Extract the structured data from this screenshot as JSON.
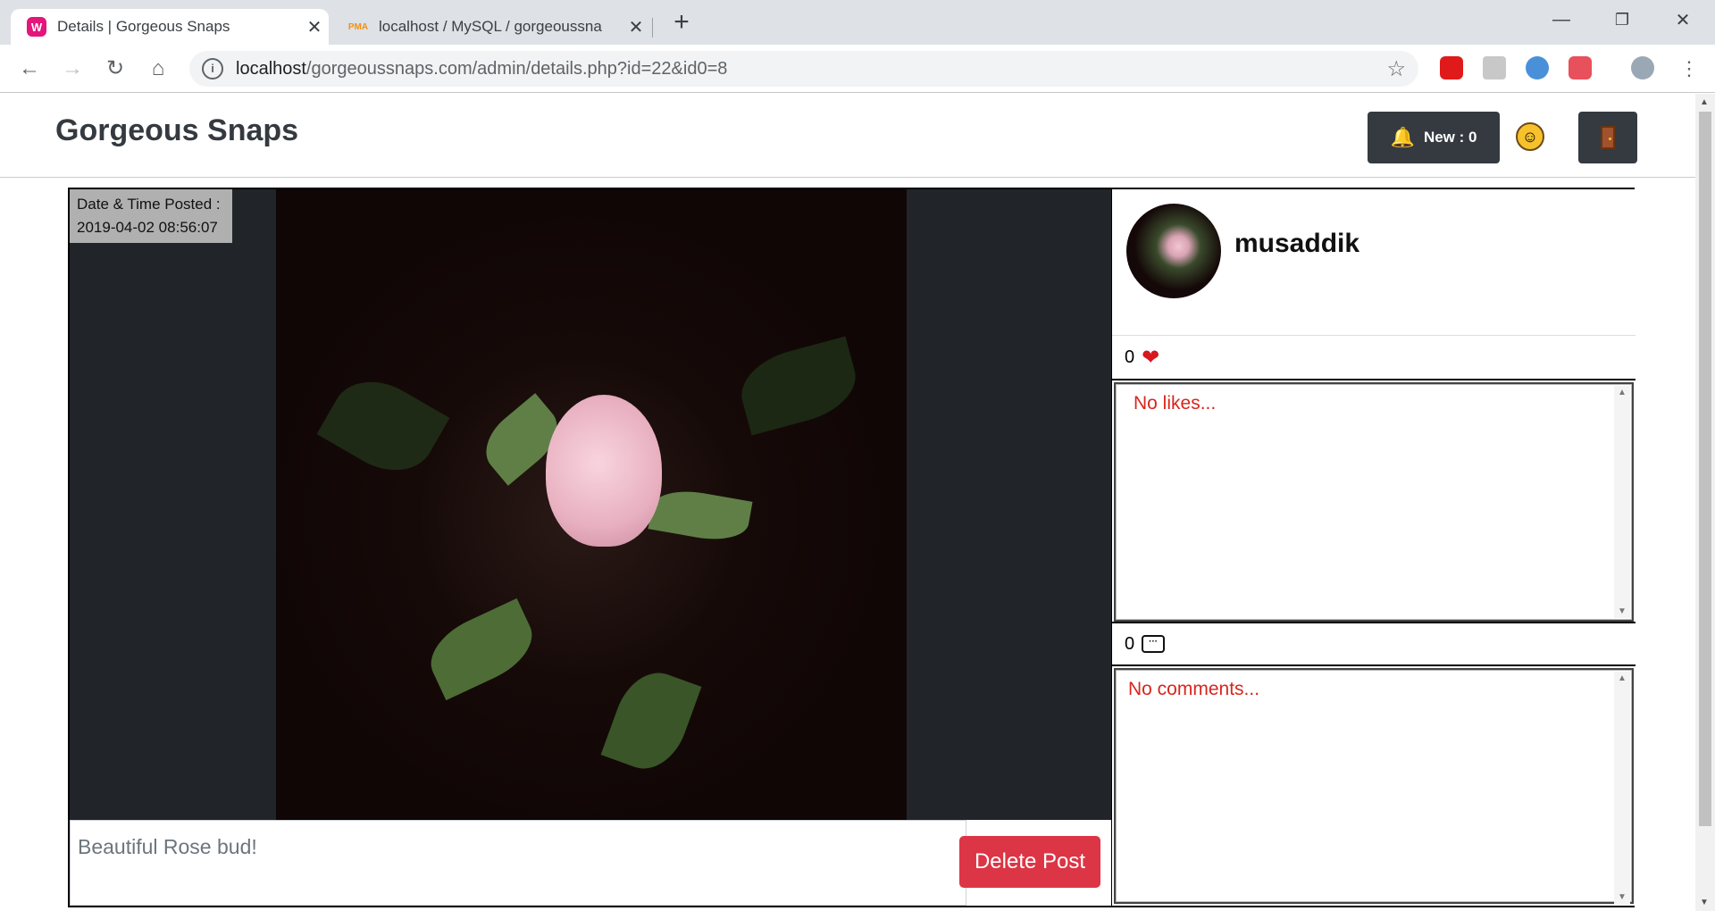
{
  "browser": {
    "tabs": [
      {
        "title": "Details | Gorgeous Snaps",
        "favicon": "W",
        "favicon_color": "#e4157b",
        "active": true
      },
      {
        "title": "localhost / MySQL / gorgeoussna",
        "favicon": "PMA",
        "favicon_color": "#f29111",
        "active": false
      }
    ],
    "new_tab": "+",
    "url_host": "localhost",
    "url_path": "/gorgeoussnaps.com/admin/details.php?id=22&id0=8",
    "window_controls": {
      "minimize": "—",
      "restore": "❐",
      "close": "✕"
    }
  },
  "navbar": {
    "brand": "Gorgeous Snaps",
    "new_label": "New : 0"
  },
  "post": {
    "timestamp_label": "Date & Time Posted :",
    "timestamp_value": "2019-04-02 08:56:07",
    "caption": "Beautiful Rose bud!",
    "delete_label": "Delete Post"
  },
  "side": {
    "username": "musaddik",
    "likes_count": "0",
    "likes_empty": "No likes...",
    "comments_count": "0",
    "comments_empty": "No comments..."
  },
  "colors": {
    "accent_danger": "#dc3545",
    "navbar_dark": "#343a40",
    "empty_text": "#d7261e"
  }
}
